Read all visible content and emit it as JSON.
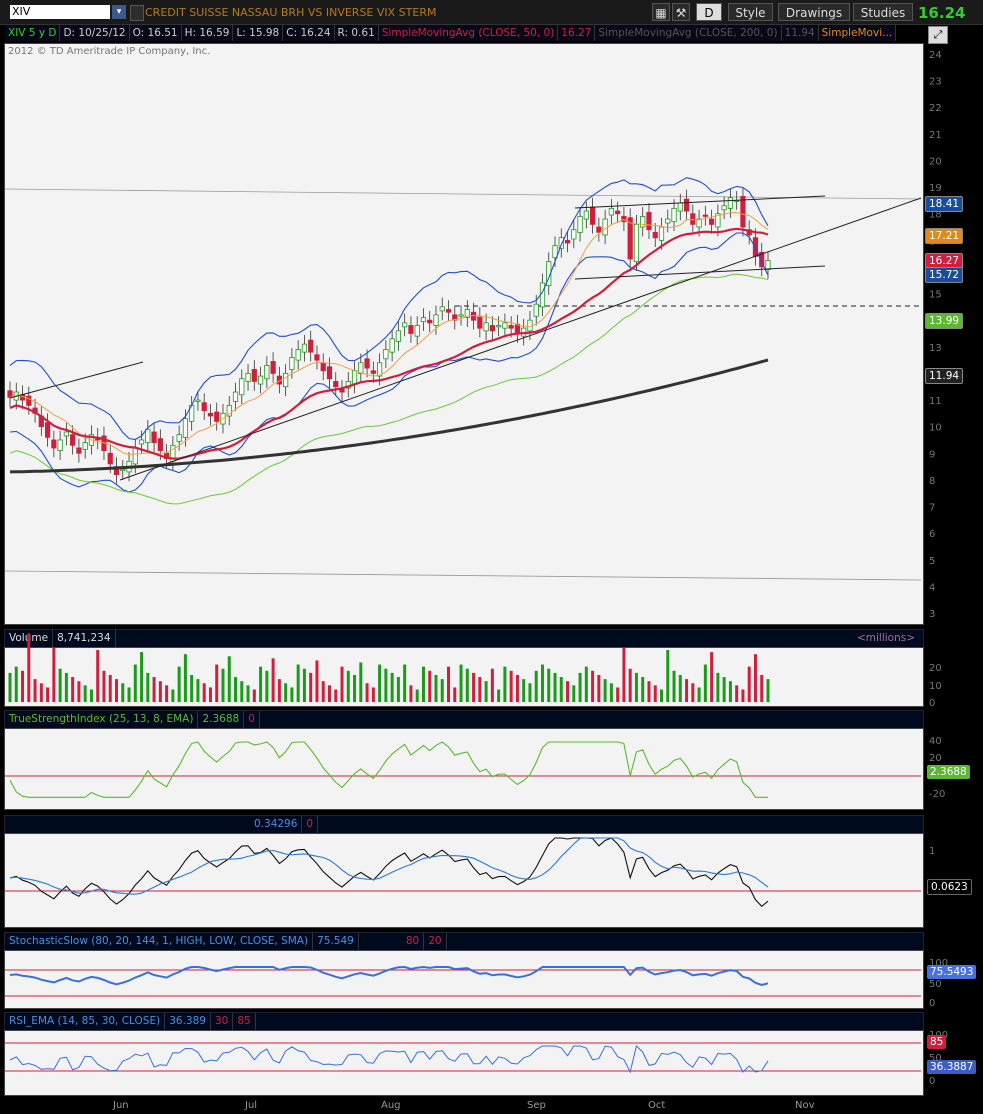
{
  "toolbar": {
    "symbol": "XIV",
    "description": "CREDIT SUISSE NASSAU BRH VS INVERSE VIX STERM",
    "d_label": "D",
    "style_label": "Style",
    "drawings_label": "Drawings",
    "studies_label": "Studies",
    "last_price": "16.24"
  },
  "infobar": {
    "period": "XIV 5 y D",
    "date": "D: 10/25/12",
    "open": "O: 16.51",
    "high": "H: 16.59",
    "low": "L: 15.98",
    "close": "C: 16.24",
    "range": "R: 0.61",
    "sma50": "SimpleMovingAvg (CLOSE, 50, 0)",
    "sma50_val": "16.27",
    "sma200": "SimpleMovingAvg (CLOSE, 200, 0)",
    "sma200_val": "11.94",
    "sma_more": "SimpleMovi..."
  },
  "copyright": "2012 © TD Ameritrade IP Company, Inc.",
  "volume": {
    "label": "Volume",
    "value": "8,741,234",
    "unit": "<millions>"
  },
  "tsi": {
    "label": "TrueStrengthIndex (25, 13, 8, EMA)",
    "value": "2.3688",
    "zero": "0"
  },
  "osc": {
    "value": "0.34296",
    "zero": "0",
    "badge": "0.0623"
  },
  "stoch": {
    "label": "StochasticSlow (80, 20, 144, 1, HIGH, LOW, CLOSE, SMA)",
    "value": "75.549",
    "over": "80",
    "under": "20",
    "badge": "75.5493"
  },
  "rsi": {
    "label": "RSI_EMA (14, 85, 30, CLOSE)",
    "value": "36.389",
    "lower": "30",
    "upper": "85",
    "badge_upper": "85",
    "badge": "36.3887"
  },
  "price_badges": [
    {
      "text": "18.41",
      "color": "#1a4d99"
    },
    {
      "text": "17.21",
      "color": "#e08a1e"
    },
    {
      "text": "16.27",
      "color": "#d01f3c"
    },
    {
      "text": "15.72",
      "color": "#1a4d99"
    },
    {
      "text": "13.99",
      "color": "#5cb82e"
    },
    {
      "text": "11.94",
      "color": "#222222"
    }
  ],
  "chart_data": {
    "type": "candlestick",
    "title": "CREDIT SUISSE NASSAU BRH VS INVERSE VIX STERM",
    "ylim": [
      2.5,
      24.5
    ],
    "y_ticks": [
      3,
      4,
      5,
      6,
      7,
      8,
      9,
      10,
      11,
      12,
      13,
      14,
      15,
      16,
      17,
      18,
      19,
      20,
      21,
      22,
      23,
      24
    ],
    "x_ticks": [
      "Jun",
      "Jul",
      "Aug",
      "Sep",
      "Oct",
      "Nov"
    ],
    "closes": [
      11.1,
      11.3,
      11.0,
      10.8,
      10.5,
      10.0,
      9.6,
      9.2,
      9.5,
      9.8,
      9.3,
      9.0,
      9.4,
      9.7,
      9.5,
      9.1,
      8.6,
      8.2,
      8.4,
      8.7,
      9.2,
      9.5,
      9.9,
      9.4,
      9.1,
      8.8,
      9.3,
      9.7,
      10.3,
      10.8,
      11.0,
      10.6,
      10.4,
      10.2,
      10.5,
      10.8,
      11.3,
      11.8,
      12.0,
      11.7,
      11.9,
      12.3,
      12.0,
      11.6,
      12.0,
      12.6,
      12.9,
      13.1,
      12.8,
      12.5,
      12.1,
      11.8,
      11.5,
      11.3,
      11.7,
      12.1,
      12.4,
      12.2,
      12.0,
      12.4,
      12.9,
      13.3,
      13.6,
      13.9,
      13.5,
      13.8,
      14.1,
      13.9,
      14.2,
      14.5,
      14.3,
      14.0,
      14.2,
      14.4,
      14.0,
      13.7,
      13.9,
      13.6,
      13.8,
      13.9,
      13.7,
      13.5,
      13.7,
      14.0,
      14.6,
      15.4,
      16.2,
      16.8,
      17.1,
      16.9,
      17.4,
      17.9,
      18.1,
      17.6,
      17.3,
      17.8,
      18.2,
      18.0,
      17.7,
      16.3,
      17.6,
      17.9,
      17.4,
      17.1,
      17.5,
      17.8,
      18.2,
      18.4,
      18.1,
      17.6,
      17.8,
      17.9,
      17.6,
      18.0,
      18.3,
      18.6,
      18.5,
      17.5,
      17.2,
      16.4,
      16.0,
      16.24
    ],
    "sma50_last": 16.27,
    "sma200_last": 11.94,
    "bb_upper_last": 18.41,
    "bb_lower_last": 15.72,
    "ema_last": 17.21,
    "sma_green_last": 13.99
  }
}
